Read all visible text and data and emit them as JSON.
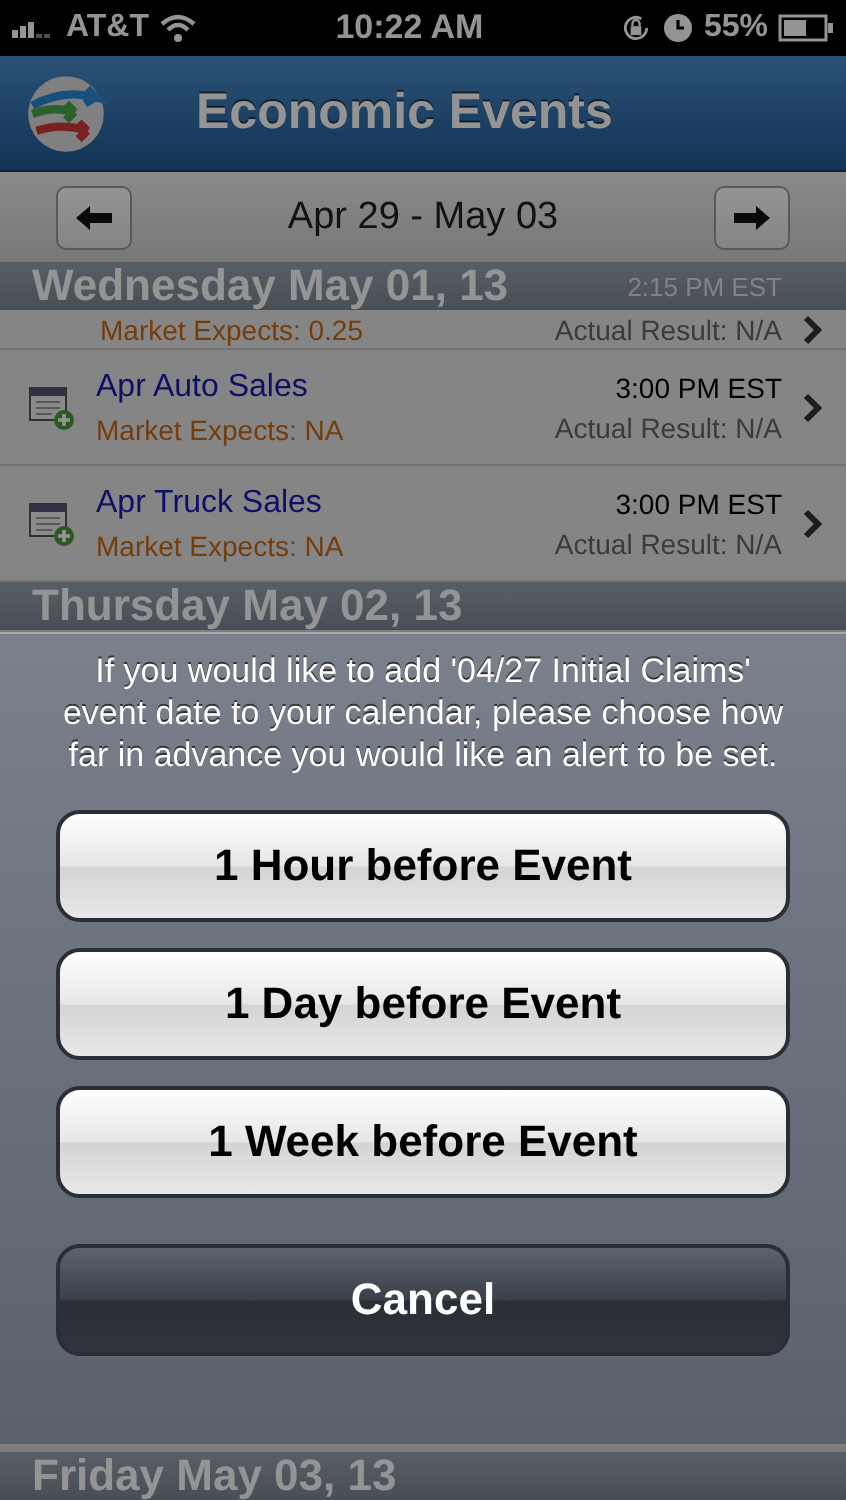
{
  "status_bar": {
    "carrier": "AT&T",
    "time": "10:22 AM",
    "battery": "55%"
  },
  "nav_bar": {
    "title": "Economic Events"
  },
  "week_bar": {
    "range": "Apr 29 - May 03"
  },
  "days": [
    {
      "title": "Wednesday May 01, 13",
      "rows": [
        {
          "kind": "partial",
          "time": "2:15 PM EST",
          "expects": "Market Expects: 0.25",
          "actual": "Actual Result: N/A"
        },
        {
          "kind": "event",
          "name": "Apr Auto Sales",
          "time": "3:00 PM EST",
          "expects": "Market Expects: NA",
          "actual": "Actual Result: N/A"
        },
        {
          "kind": "event",
          "name": "Apr Truck Sales",
          "time": "3:00 PM EST",
          "expects": "Market Expects: NA",
          "actual": "Actual Result: N/A"
        }
      ]
    },
    {
      "title": "Thursday May 02, 13"
    },
    {
      "title": "Friday May 03, 13"
    }
  ],
  "action_sheet": {
    "message": "If you would like to add '04/27 Initial Claims' event date to your calendar, please choose how far in advance you would like an alert to be set.",
    "buttons": [
      {
        "kind": "option",
        "label": "1 Hour before Event"
      },
      {
        "kind": "option",
        "label": "1 Day before Event"
      },
      {
        "kind": "option",
        "label": "1 Week before Event"
      },
      {
        "kind": "cancel",
        "label": "Cancel"
      }
    ]
  }
}
